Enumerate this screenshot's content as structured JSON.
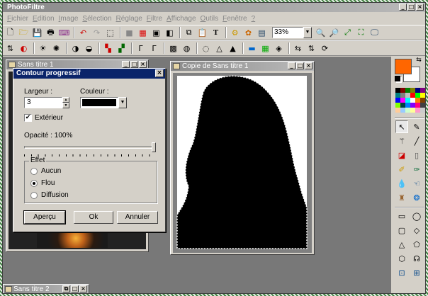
{
  "app": {
    "title": "PhotoFiltre"
  },
  "menu": [
    {
      "k": "F",
      "r": "ichier"
    },
    {
      "k": "E",
      "r": "dition"
    },
    {
      "k": "I",
      "r": "mage"
    },
    {
      "k": "S",
      "r": "élection"
    },
    {
      "k": "R",
      "r": "églage"
    },
    {
      "k": "F",
      "r": "iltre"
    },
    {
      "k": "A",
      "r": "ffichage"
    },
    {
      "k": "O",
      "r": "utils"
    },
    {
      "k": "F",
      "r": "enêtre"
    },
    {
      "k": "?",
      "r": ""
    }
  ],
  "toolbar": {
    "zoom": "33%"
  },
  "window1": {
    "title": "Sans titre 1"
  },
  "window2": {
    "title": "Copie de Sans titre 1"
  },
  "window3": {
    "title": "Sans titre 2"
  },
  "dialog": {
    "title": "Contour progressif",
    "width_label": "Largeur :",
    "width_value": "3",
    "color_label": "Couleur :",
    "color_value": "#000000",
    "exterior_label": "Extérieur",
    "exterior_checked": true,
    "opacity_label": "Opacité : 100%",
    "opacity": 100,
    "effect_label": "Effet",
    "effects": [
      "Aucun",
      "Flou",
      "Diffusion"
    ],
    "effect_selected": 1,
    "preview": "Aperçu",
    "ok": "Ok",
    "cancel": "Annuler"
  },
  "colors": {
    "foreground": "#ff6600",
    "background": "#ffffff"
  }
}
